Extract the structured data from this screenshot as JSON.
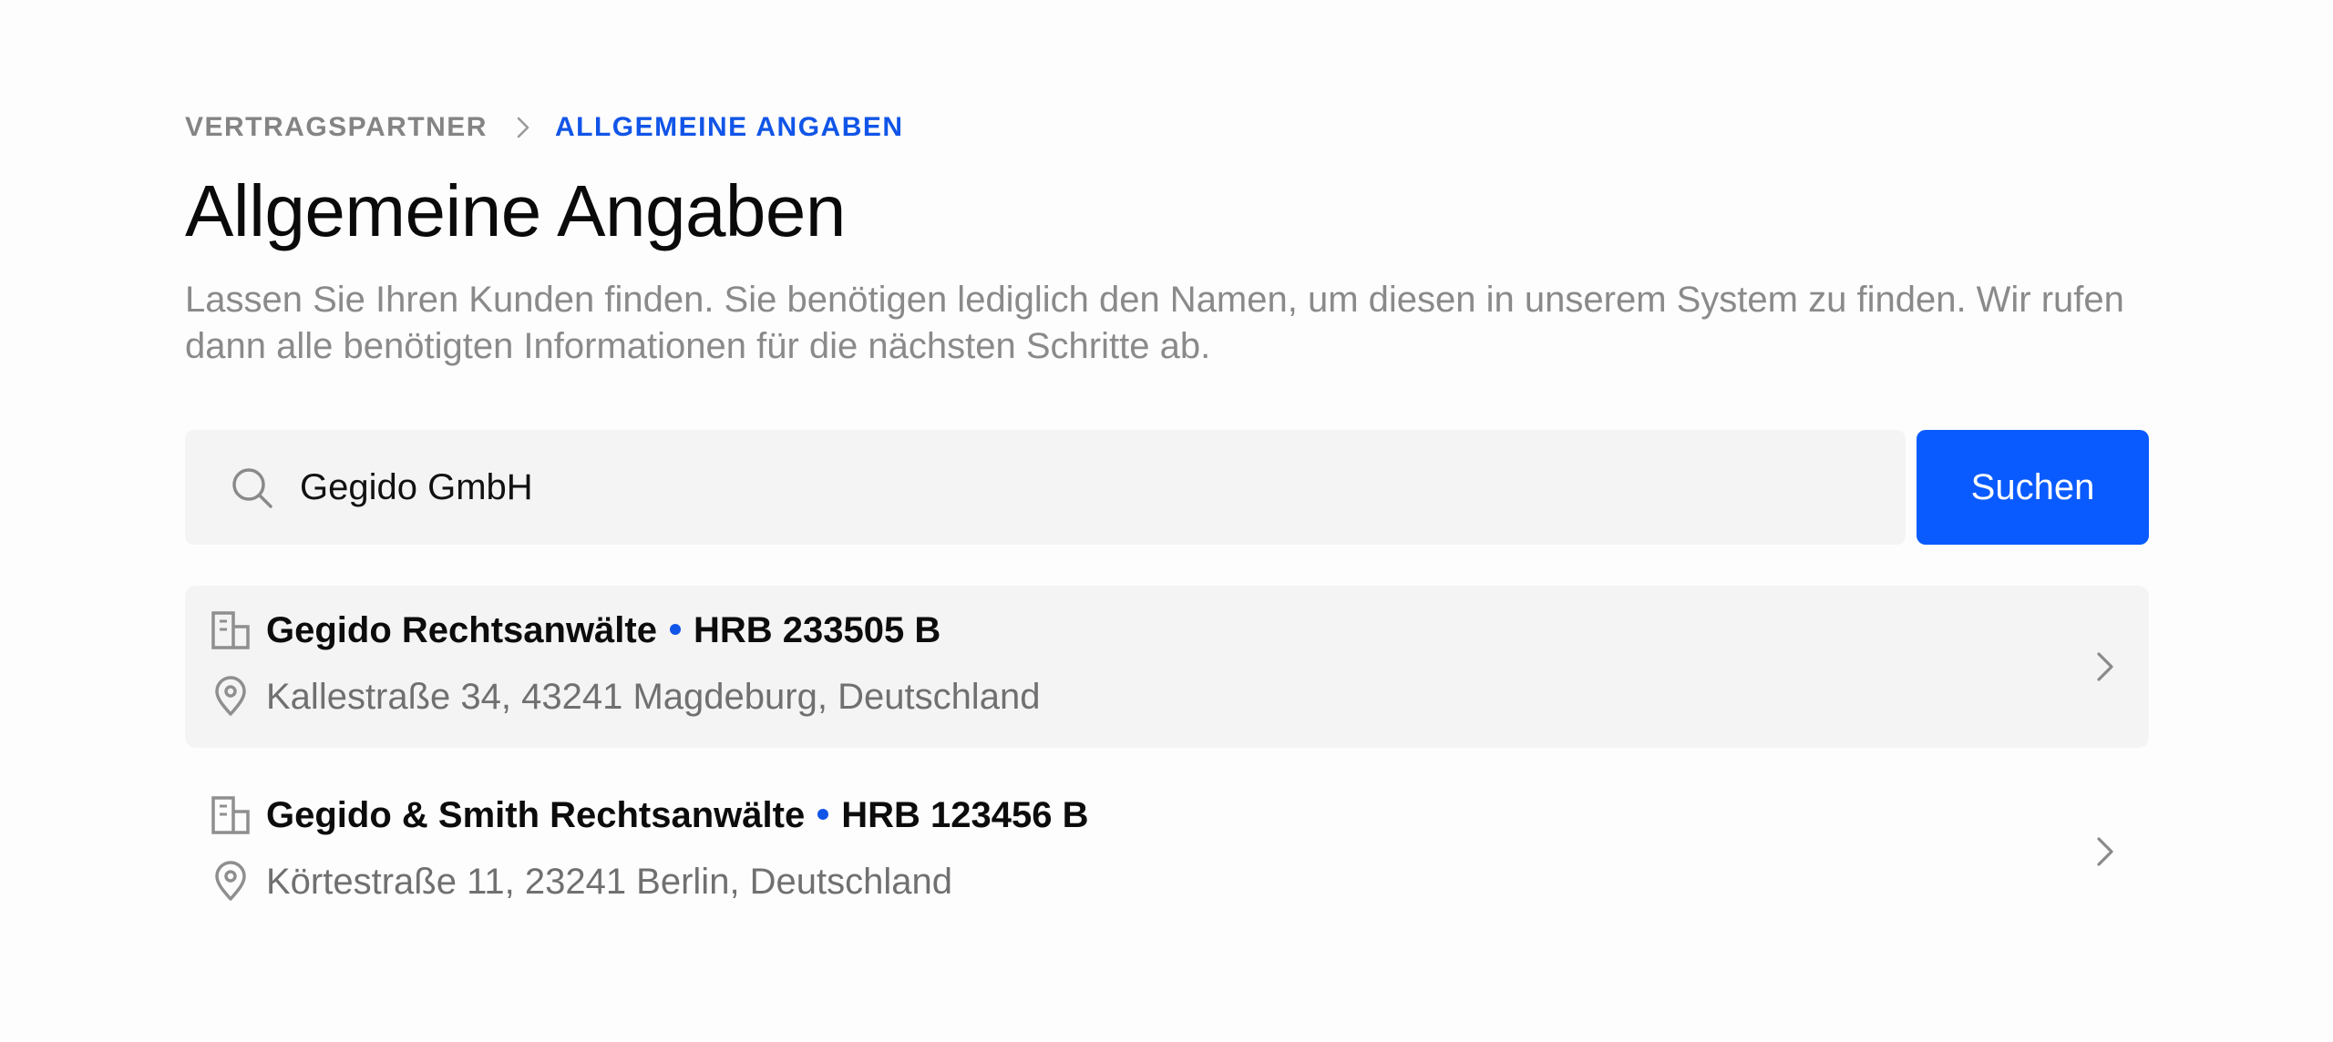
{
  "breadcrumb": {
    "parent": "VERTRAGSPARTNER",
    "current": "ALLGEMEINE ANGABEN"
  },
  "page": {
    "title": "Allgemeine Angaben",
    "description": "Lassen Sie Ihren Kunden finden. Sie benötigen lediglich den Namen, um diesen in unserem System zu finden. Wir rufen dann alle benötigten Informationen für die nächsten Schritte ab."
  },
  "search": {
    "value": "Gegido GmbH",
    "button_label": "Suchen"
  },
  "results": [
    {
      "name": "Gegido Rechtsanwälte",
      "register": "HRB 233505 B",
      "address": "Kallestraße 34, 43241 Magdeburg, Deutschland",
      "highlighted": true
    },
    {
      "name": "Gegido & Smith Rechtsanwälte",
      "register": "HRB 123456 B",
      "address": "Körtestraße 11, 23241 Berlin, Deutschland",
      "highlighted": false
    }
  ],
  "colors": {
    "accent": "#0a5bff",
    "breadcrumb_active": "#1155e8",
    "muted_text": "#8a8a8a",
    "surface": "#f4f4f4"
  },
  "icons": {
    "search": "search-icon",
    "separator": "chevron-right-icon",
    "company": "building-icon",
    "location": "map-pin-icon",
    "open": "chevron-right-icon"
  }
}
